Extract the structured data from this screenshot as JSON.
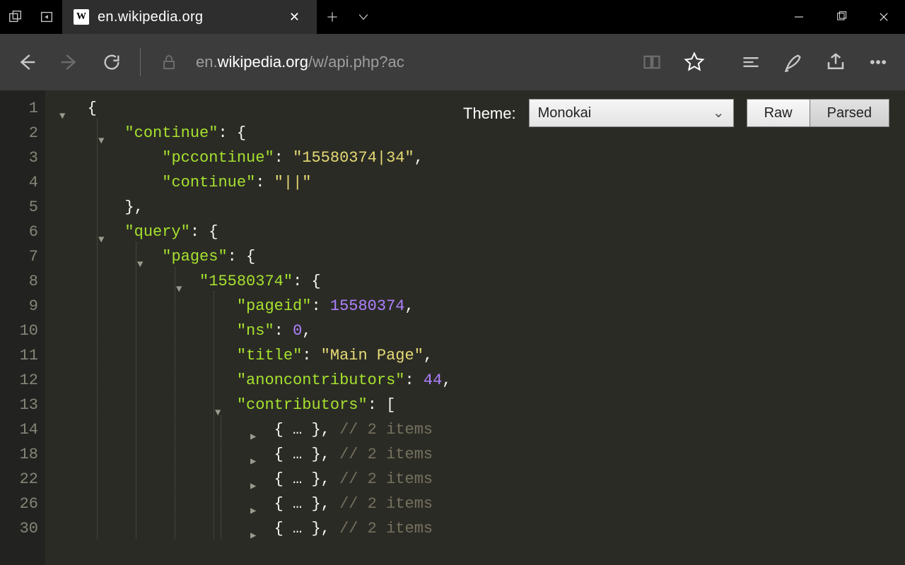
{
  "tab": {
    "title": "en.wikipedia.org",
    "favicon_letter": "W"
  },
  "address": {
    "prefix": "en.",
    "host": "wikipedia.org",
    "path": "/w/api.php?ac"
  },
  "viewer": {
    "theme_label": "Theme:",
    "theme_value": "Monokai",
    "raw_label": "Raw",
    "parsed_label": "Parsed"
  },
  "code": {
    "line_numbers": [
      "1",
      "2",
      "3",
      "4",
      "5",
      "6",
      "7",
      "8",
      "9",
      "10",
      "11",
      "12",
      "13",
      "14",
      "18",
      "22",
      "26",
      "30"
    ],
    "keys": {
      "continue": "continue",
      "pccontinue": "pccontinue",
      "continue2": "continue",
      "query": "query",
      "pages": "pages",
      "pageid_key": "15580374",
      "pageid": "pageid",
      "ns": "ns",
      "title": "title",
      "anon": "anoncontributors",
      "contributors": "contributors"
    },
    "vals": {
      "pccontinue": "15580374|34",
      "continue": "||",
      "pageid": "15580374",
      "ns": "0",
      "title": "Main Page",
      "anon": "44"
    },
    "collapsed": {
      "placeholder": "{ … }",
      "comment": "// 2 items"
    }
  }
}
